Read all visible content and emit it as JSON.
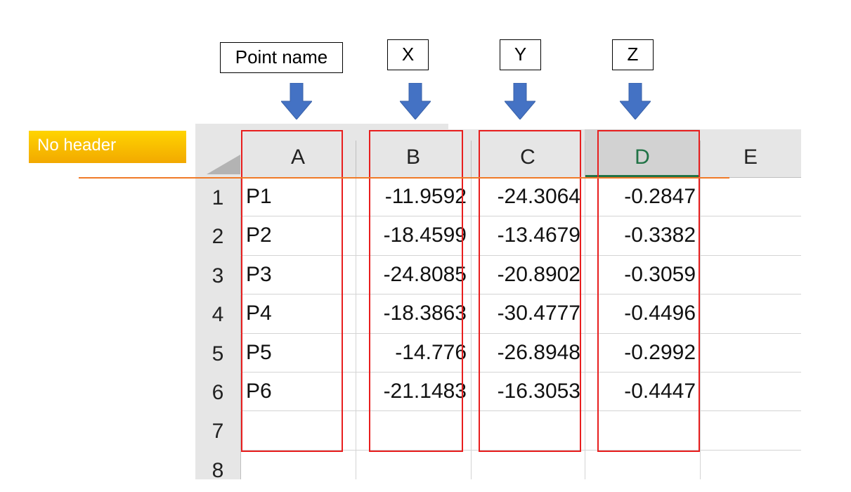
{
  "labels": {
    "point_name": "Point name",
    "x": "X",
    "y": "Y",
    "z": "Z"
  },
  "note": {
    "text": "No header"
  },
  "columns": [
    "A",
    "B",
    "C",
    "D",
    "E"
  ],
  "active_column": "D",
  "row_numbers": [
    "1",
    "2",
    "3",
    "4",
    "5",
    "6",
    "7",
    "8"
  ],
  "rows": [
    [
      "P1",
      "-11.9592",
      "-24.3064",
      "-0.2847"
    ],
    [
      "P2",
      "-18.4599",
      "-13.4679",
      "-0.3382"
    ],
    [
      "P3",
      "-24.8085",
      "-20.8902",
      "-0.3059"
    ],
    [
      "P4",
      "-18.3863",
      "-30.4777",
      "-0.4496"
    ],
    [
      "P5",
      "-14.776",
      "-26.8948",
      "-0.2992"
    ],
    [
      "P6",
      "-21.1483",
      "-16.3053",
      "-0.4447"
    ]
  ],
  "colors": {
    "arrow": "#4472c4",
    "highlight_box": "#e81e1e",
    "note_bg": "#f5b800",
    "active_header": "#217346",
    "divider_line": "#f07a28"
  }
}
